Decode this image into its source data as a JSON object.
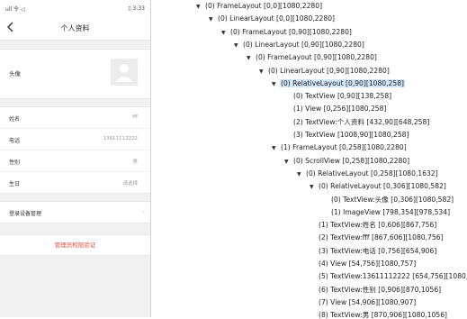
{
  "phone": {
    "status_left": "ull 令 ◁",
    "status_right": "▯ 3:33",
    "title": "个人资料",
    "avatar_label": "头像",
    "rows": [
      {
        "label": "姓名",
        "value": "fff"
      },
      {
        "label": "电话",
        "value": "13611112222"
      },
      {
        "label": "性别",
        "value": "男"
      },
      {
        "label": "生日",
        "value": "请选择"
      }
    ],
    "device_item": "登录设备管理",
    "logout": "管理员权限验证",
    "chevron": "›"
  },
  "tree": [
    {
      "indent": 0,
      "toggle": "▼",
      "text": "(0) FrameLayout [0,0][1080,2280]"
    },
    {
      "indent": 1,
      "toggle": "▼",
      "text": "(0) LinearLayout [0,0][1080,2280]"
    },
    {
      "indent": 2,
      "toggle": "▼",
      "text": "(0) FrameLayout [0,90][1080,2280]"
    },
    {
      "indent": 3,
      "toggle": "▼",
      "text": "(0) LinearLayout [0,90][1080,2280]"
    },
    {
      "indent": 4,
      "toggle": "▼",
      "text": "(0) FrameLayout [0,90][1080,2280]"
    },
    {
      "indent": 5,
      "toggle": "▼",
      "text": "(0) LinearLayout [0,90][1080,2280]"
    },
    {
      "indent": 6,
      "toggle": "▼",
      "text": "(0) RelativeLayout [0,90][1080,258]",
      "selected": true
    },
    {
      "indent": 7,
      "toggle": "",
      "text": "(0) TextView [0,90][138,258]"
    },
    {
      "indent": 7,
      "toggle": "",
      "text": "(1) View [0,256][1080,258]"
    },
    {
      "indent": 7,
      "toggle": "",
      "text": "(2) TextView:个人资料 [432,90][648,258]"
    },
    {
      "indent": 7,
      "toggle": "",
      "text": "(3) TextView [1008,90][1080,258]"
    },
    {
      "indent": 6,
      "toggle": "▼",
      "text": "(1) FrameLayout [0,258][1080,2280]"
    },
    {
      "indent": 7,
      "toggle": "▼",
      "text": "(0) ScrollView [0,258][1080,2280]"
    },
    {
      "indent": 8,
      "toggle": "▼",
      "text": "(0) RelativeLayout [0,258][1080,1632]"
    },
    {
      "indent": 9,
      "toggle": "▼",
      "text": "(0) RelativeLayout [0,306][1080,582]"
    },
    {
      "indent": 10,
      "toggle": "",
      "text": "(0) TextView:头像 [0,306][1080,582]"
    },
    {
      "indent": 10,
      "toggle": "",
      "text": "(1) ImageView [798,354][978,534]"
    },
    {
      "indent": 9,
      "toggle": "",
      "text": "(1) TextView:姓名 [0,606][867,756]"
    },
    {
      "indent": 9,
      "toggle": "",
      "text": "(2) TextView:fff [867,606][1080,756]"
    },
    {
      "indent": 9,
      "toggle": "",
      "text": "(3) TextView:电话 [0,756][654,906]"
    },
    {
      "indent": 9,
      "toggle": "",
      "text": "(4) View [54,756][1080,757]"
    },
    {
      "indent": 9,
      "toggle": "",
      "text": "(5) TextView:13611112222 [654,756][1080,906]"
    },
    {
      "indent": 9,
      "toggle": "",
      "text": "(6) TextView:性别 [0,906][870,1056]"
    },
    {
      "indent": 9,
      "toggle": "",
      "text": "(7) View [54,906][1080,907]"
    },
    {
      "indent": 9,
      "toggle": "",
      "text": "(8) TextView:男 [870,906][1080,1056]"
    }
  ]
}
